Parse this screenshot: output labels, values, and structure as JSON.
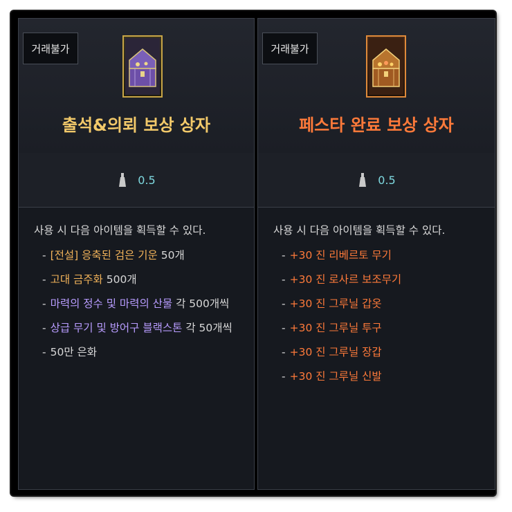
{
  "left_card": {
    "tag": "거래불가",
    "title": "출석&의뢰 보상 상자",
    "weight": "0.5",
    "intro": "사용 시 다음 아이템을 획득할 수 있다.",
    "items": [
      {
        "parts": [
          {
            "text": "[전설] 응축된 검은 기운",
            "color": "orange"
          },
          {
            "text": " 50개",
            "color": "white"
          }
        ]
      },
      {
        "parts": [
          {
            "text": "고대 금주화",
            "color": "orange"
          },
          {
            "text": " 500개",
            "color": "white"
          }
        ]
      },
      {
        "parts": [
          {
            "text": "마력의 정수 및 마력의 산물",
            "color": "purple"
          },
          {
            "text": " 각 500개씩",
            "color": "white"
          }
        ]
      },
      {
        "parts": [
          {
            "text": "상급 무기 및 방어구 블랙스톤",
            "color": "purple"
          },
          {
            "text": " 각 50개씩",
            "color": "white"
          }
        ]
      },
      {
        "parts": [
          {
            "text": "50만 은화",
            "color": "white"
          }
        ]
      }
    ]
  },
  "right_card": {
    "tag": "거래불가",
    "title": "페스타 완료 보상 상자",
    "weight": "0.5",
    "intro": "사용 시 다음 아이템을 획득할 수 있다.",
    "items": [
      {
        "parts": [
          {
            "text": "+30 진 리베르토 무기",
            "color": "red"
          }
        ]
      },
      {
        "parts": [
          {
            "text": "+30 진 로사르 보조무기",
            "color": "red"
          }
        ]
      },
      {
        "parts": [
          {
            "text": "+30 진 그루닐 갑옷",
            "color": "red"
          }
        ]
      },
      {
        "parts": [
          {
            "text": "+30 진 그루닐 투구",
            "color": "red"
          }
        ]
      },
      {
        "parts": [
          {
            "text": "+30 진 그루닐 장갑",
            "color": "red"
          }
        ]
      },
      {
        "parts": [
          {
            "text": "+30 진 그루닐 신발",
            "color": "red"
          }
        ]
      }
    ]
  },
  "icons": {
    "chest_left": "treasure-chest-purple-icon",
    "chest_right": "treasure-chest-gold-icon",
    "weight": "weight-icon"
  },
  "colors": {
    "orange": "#f2b35a",
    "purple": "#b89cff",
    "white": "#d8d8d8",
    "red": "#ff7a3a",
    "weight_value": "#7fd9e0"
  }
}
